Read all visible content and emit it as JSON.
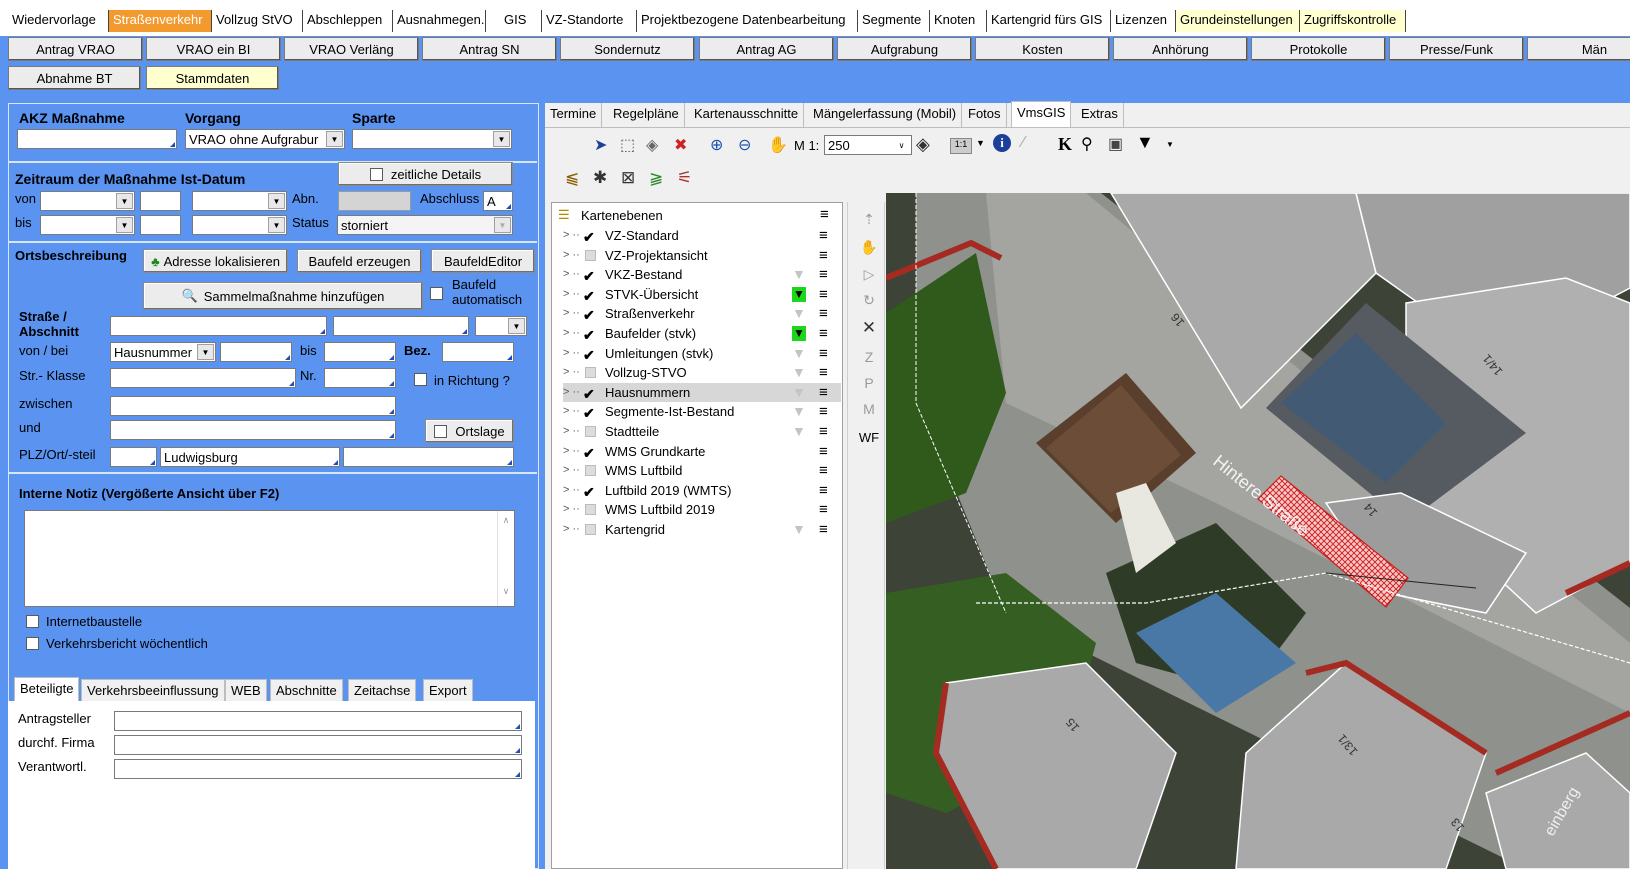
{
  "menu": {
    "items": [
      "Wiedervorlage",
      "Straßenverkehr",
      "Vollzug StVO",
      "Abschleppen",
      "Ausnahmegen.",
      "GIS",
      "VZ-Standorte",
      "Projektbezogene Datenbearbeitung",
      "Segmente",
      "Knoten",
      "Kartengrid fürs GIS",
      "Lizenzen",
      "Grundeinstellungen",
      "Zugriffskontrolle"
    ],
    "active_color": "#f39a2e",
    "yellow_color": "#ffffd0"
  },
  "tabs2": {
    "row1": [
      "Antrag VRAO",
      "VRAO ein BI",
      "VRAO Verläng",
      "Antrag SN",
      "Sondernutz",
      "Antrag AG",
      "Aufgrabung",
      "Kosten",
      "Anhörung",
      "Protokolle",
      "Presse/Funk",
      "Män"
    ],
    "row2": [
      "Abnahme BT",
      "Stammdaten"
    ]
  },
  "form": {
    "akz_label": "AKZ Maßnahme",
    "vorgang_label": "Vorgang",
    "sparte_label": "Sparte",
    "akz_value": "",
    "vorgang_value": "VRAO ohne Aufgrabur",
    "sparte_value": "",
    "zeitraum_label": "Zeitraum der Maßnahme Ist-Datum",
    "zeitliche_btn": "zeitliche Details",
    "von": "von",
    "bis": "bis",
    "abn": "Abn.",
    "abschluss": "Abschluss",
    "abschluss_value": "A",
    "status": "Status",
    "status_value": "storniert",
    "orts_label": "Ortsbeschreibung",
    "adresse_btn": "Adresse lokalisieren",
    "baufeld_btn": "Baufeld erzeugen",
    "baufeldeditor_btn": "BaufeldEditor",
    "sammel_btn": "Sammelmaßnahme hinzufügen",
    "baufeld_auto": "Baufeld automatisch",
    "strasse_label": "Straße / Abschnitt",
    "vonbei": "von / bei",
    "hausnummer": "Hausnummer",
    "bis2": "bis",
    "bez": "Bez.",
    "strklasse": "Str.- Klasse",
    "nr": "Nr.",
    "in_richtung": "in Richtung ?",
    "zwischen": "zwischen",
    "und": "und",
    "ortslage": "Ortslage",
    "plz": "PLZ/Ort/-steil",
    "ort_value": "Ludwigsburg",
    "notiz_label": "Interne Notiz (Vergößerte Ansicht über F2)",
    "internet": "Internetbaustelle",
    "verkehrsbericht": "Verkehrsbericht wöchentlich"
  },
  "bottom_tabs": [
    "Beteiligte",
    "Verkehrsbeeinflussung",
    "WEB",
    "Abschnitte",
    "Zeitachse",
    "Export"
  ],
  "bottom_fields": [
    "Antragsteller",
    "durchf. Firma",
    "Verantwortl."
  ],
  "right_tabs": [
    "Termine",
    "Regelpläne",
    "Kartenausschnitte",
    "Mängelerfassung (Mobil)",
    "Fotos",
    "VmsGIS",
    "Extras"
  ],
  "toolbar": {
    "scale_prefix": "M 1:",
    "scale_value": "250",
    "k_label": "K"
  },
  "layers": {
    "root": "Kartenebenen",
    "items": [
      {
        "name": "VZ-Standard",
        "checked": true,
        "filter": "none"
      },
      {
        "name": "VZ-Projektansicht",
        "checked": false,
        "filter": "none"
      },
      {
        "name": "VKZ-Bestand",
        "checked": true,
        "filter": "grey"
      },
      {
        "name": "STVK-Übersicht",
        "checked": true,
        "filter": "green"
      },
      {
        "name": "Straßenverkehr",
        "checked": true,
        "filter": "grey"
      },
      {
        "name": "Baufelder (stvk)",
        "checked": true,
        "filter": "green"
      },
      {
        "name": "Umleitungen (stvk)",
        "checked": true,
        "filter": "grey"
      },
      {
        "name": "Vollzug-STVO",
        "checked": false,
        "filter": "grey"
      },
      {
        "name": "Hausnummern",
        "checked": true,
        "filter": "grey",
        "selected": true
      },
      {
        "name": "Segmente-Ist-Bestand",
        "checked": true,
        "filter": "grey"
      },
      {
        "name": "Stadtteile",
        "checked": false,
        "filter": "grey"
      },
      {
        "name": "WMS Grundkarte",
        "checked": true,
        "filter": "none"
      },
      {
        "name": "WMS Luftbild",
        "checked": false,
        "filter": "none"
      },
      {
        "name": "Luftbild 2019 (WMTS)",
        "checked": true,
        "filter": "none"
      },
      {
        "name": "WMS Luftbild 2019",
        "checked": false,
        "filter": "none"
      },
      {
        "name": "Kartengrid",
        "checked": false,
        "filter": "grey"
      }
    ]
  },
  "side_tools": [
    "Z",
    "P",
    "M",
    "WF"
  ],
  "map": {
    "street": "Hintere Straße",
    "house_numbers": [
      "16",
      "14/1",
      "14",
      "15",
      "13/1",
      "13"
    ],
    "corner_text": "einberg"
  }
}
